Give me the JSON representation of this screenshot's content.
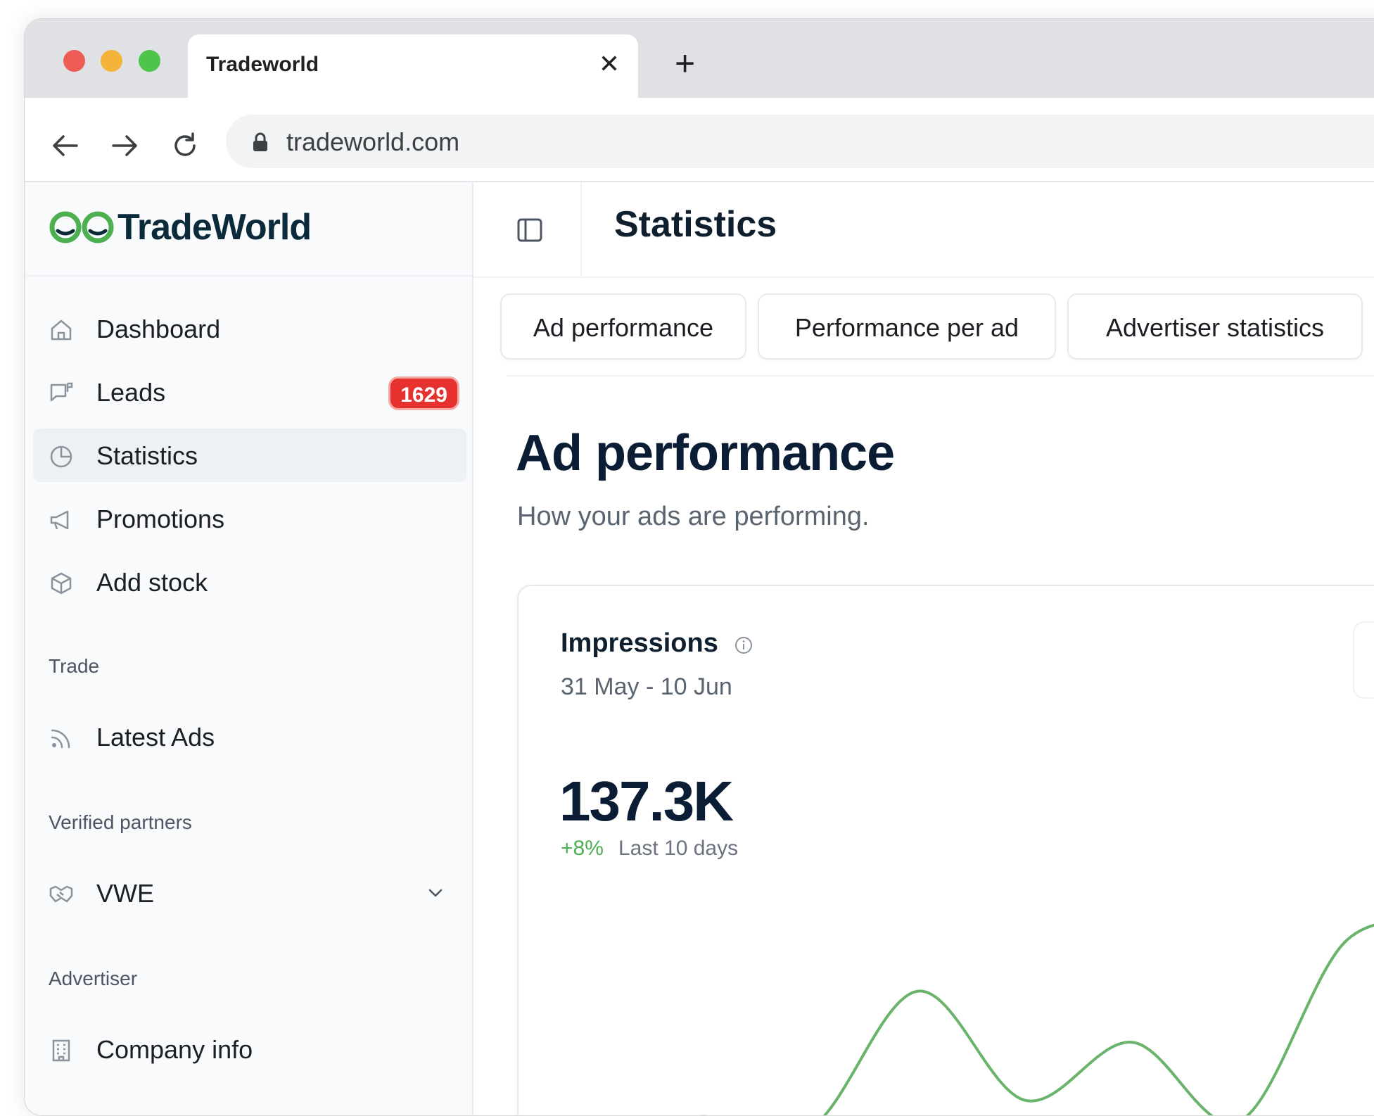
{
  "browser": {
    "tab_title": "Tradeworld",
    "tab_close": "✕",
    "new_tab": "+",
    "url": "tradeworld.com"
  },
  "brand": {
    "name": "TradeWorld",
    "accent": "#4caf50"
  },
  "sidebar": {
    "items": [
      {
        "label": "Dashboard",
        "icon": "home-icon"
      },
      {
        "label": "Leads",
        "icon": "chat-flag-icon",
        "badge": "1629"
      },
      {
        "label": "Statistics",
        "icon": "pie-chart-icon",
        "active": true
      },
      {
        "label": "Promotions",
        "icon": "megaphone-icon"
      },
      {
        "label": "Add stock",
        "icon": "box-icon"
      }
    ],
    "sections": [
      {
        "title": "Trade",
        "items": [
          {
            "label": "Latest Ads",
            "icon": "rss-icon"
          }
        ]
      },
      {
        "title": "Verified partners",
        "items": [
          {
            "label": "VWE",
            "icon": "handshake-icon",
            "expandable": true
          }
        ]
      },
      {
        "title": "Advertiser",
        "items": [
          {
            "label": "Company info",
            "icon": "building-icon"
          }
        ]
      }
    ]
  },
  "header": {
    "title": "Statistics"
  },
  "subtabs": [
    "Ad performance",
    "Performance per ad",
    "Advertiser statistics"
  ],
  "page": {
    "title": "Ad performance",
    "subtitle": "How your ads are performing."
  },
  "card": {
    "title": "Impressions",
    "range": "31 May - 10 Jun",
    "value": "137.3K",
    "change": "+8%",
    "period": "Last 10 days"
  },
  "chart_data": {
    "type": "line",
    "series": [
      {
        "values": [
          8,
          14,
          9,
          68,
          21,
          46,
          12,
          90,
          96
        ]
      }
    ],
    "color": "#6ab36a"
  }
}
